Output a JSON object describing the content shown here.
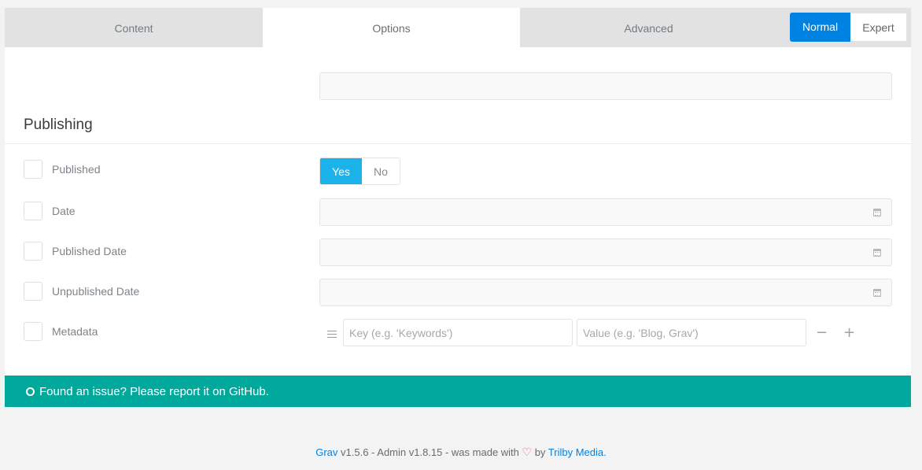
{
  "tabs": [
    {
      "label": "Content",
      "active": false
    },
    {
      "label": "Options",
      "active": true
    },
    {
      "label": "Advanced",
      "active": false
    }
  ],
  "mode": {
    "normal": "Normal",
    "expert": "Expert",
    "selected": "Normal"
  },
  "section": {
    "title": "Publishing"
  },
  "fields": {
    "published": {
      "label": "Published",
      "yes": "Yes",
      "no": "No",
      "value": "Yes"
    },
    "date": {
      "label": "Date",
      "value": ""
    },
    "published_date": {
      "label": "Published Date",
      "value": ""
    },
    "unpublished_date": {
      "label": "Unpublished Date",
      "value": ""
    },
    "metadata": {
      "label": "Metadata",
      "key_placeholder": "Key (e.g. 'Keywords')",
      "value_placeholder": "Value (e.g. 'Blog, Grav')",
      "remove": "−",
      "add": "+"
    }
  },
  "notice": {
    "text": "Found an issue? Please report it on GitHub."
  },
  "footer": {
    "grav": "Grav",
    "version_text": " v1.5.6 - Admin v1.8.15 - was made with ",
    "heart": "♡",
    "by": " by ",
    "trilby": "Trilby Media",
    "period": "."
  },
  "colors": {
    "accent_blue": "#0082e3",
    "toggle_on": "#1bb3e9",
    "notice_bg": "#00a99c",
    "heart": "#e86b4a"
  },
  "icons": [
    "calendar-icon",
    "drag-handle-icon",
    "github-icon",
    "heart-icon"
  ]
}
